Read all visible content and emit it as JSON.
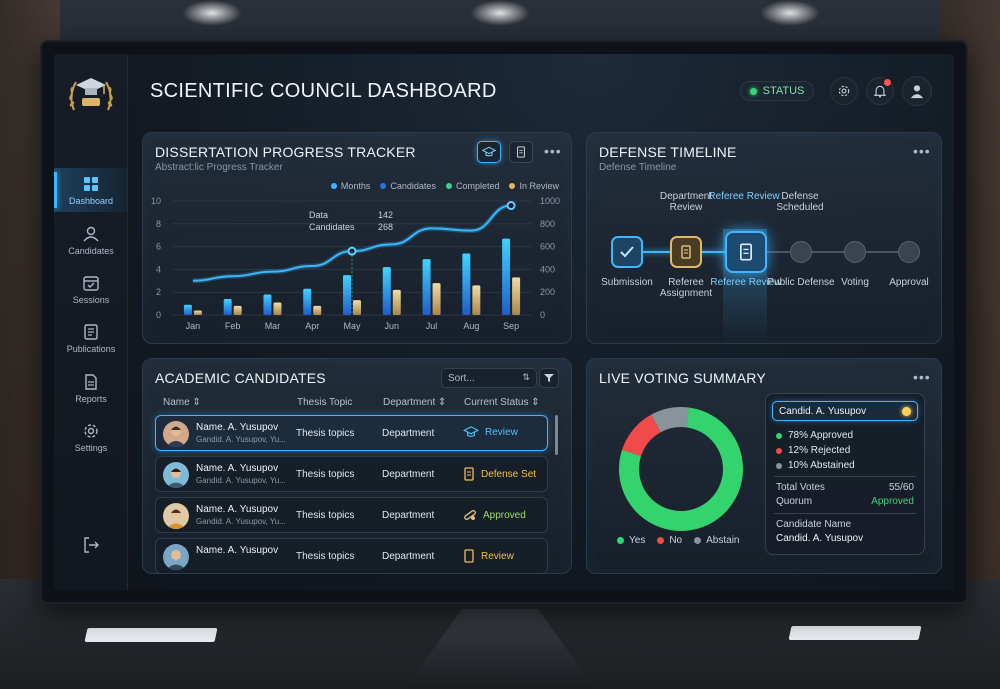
{
  "header": {
    "title": "SCIENTIFIC COUNCIL DASHBOARD",
    "status_label": "STATUS"
  },
  "sidebar": {
    "items": [
      {
        "label": "Dashboard",
        "icon": "dashboard-icon"
      },
      {
        "label": "Candidates",
        "icon": "candidates-icon"
      },
      {
        "label": "Sessions",
        "icon": "calendar-icon"
      },
      {
        "label": "Publications",
        "icon": "publications-icon"
      },
      {
        "label": "Reports",
        "icon": "reports-icon"
      },
      {
        "label": "Settings",
        "icon": "gear-icon"
      }
    ]
  },
  "tracker": {
    "title": "DISSERTATION PROGRESS TRACKER",
    "subtitle": "Abstract:lic Progress Tracker",
    "tooltip": {
      "label1": "Data",
      "value1": "142",
      "label2": "Candidates",
      "value2": "268"
    }
  },
  "chart_data": {
    "type": "bar",
    "categories": [
      "Jan",
      "Feb",
      "Mar",
      "Apr",
      "May",
      "Jun",
      "Jul",
      "Aug",
      "Sep"
    ],
    "legend": [
      "Months",
      "Candidates",
      "Completed",
      "In Review"
    ],
    "left_ticks": [
      "0",
      "2",
      "4",
      "6",
      "8",
      "10"
    ],
    "right_ticks": [
      "0",
      "200",
      "400",
      "600",
      "800",
      "1000"
    ],
    "ylim_left": [
      0,
      10
    ],
    "ylim_right": [
      0,
      1000
    ],
    "series": [
      {
        "name": "Candidates",
        "axis": "left",
        "values": [
          0.9,
          1.4,
          1.8,
          2.3,
          3.5,
          4.2,
          4.9,
          5.4,
          6.7
        ],
        "color": "#2f8fe8"
      },
      {
        "name": "In Review",
        "axis": "left",
        "values": [
          0.4,
          0.8,
          1.1,
          0.8,
          1.3,
          2.2,
          2.8,
          2.6,
          3.3
        ],
        "color": "#e2c27d"
      },
      {
        "name": "Months",
        "axis": "right",
        "values": [
          300,
          340,
          380,
          430,
          560,
          620,
          760,
          740,
          960
        ],
        "color": "#38b8ff"
      }
    ],
    "colors": {
      "Months": "#38b8ff",
      "Candidates": "#2f6fe0",
      "Completed": "#3fd190",
      "In Review": "#e2b867"
    }
  },
  "timeline": {
    "title": "DEFENSE TIMELINE",
    "subtitle": "Defense Timeline",
    "top_labels": [
      "Department Review",
      "Referee Review",
      "Defense Scheduled"
    ],
    "steps": [
      "Submission",
      "Referee Assignment",
      "Referee Review",
      "Public Defense",
      "Voting",
      "Approval"
    ]
  },
  "candidates": {
    "title": "ACADEMIC CANDIDATES",
    "sort_placeholder": "Sort...",
    "columns": [
      "Name",
      "Thesis Topic",
      "Department",
      "Current Status"
    ],
    "rows": [
      {
        "name": "Name. A. Yusupov",
        "sub": "Gandid. A. Yusupov, Yu...",
        "topic": "Thesis topics",
        "dept": "Department",
        "status": "Review",
        "status_icon": "graduation-cap-icon",
        "status_color": "#4fc3ff"
      },
      {
        "name": "Name. A. Yusupov",
        "sub": "Gandid. A. Yusupov, Yu...",
        "topic": "Thesis topics",
        "dept": "Department",
        "status": "Defense Set",
        "status_icon": "scroll-icon",
        "status_color": "#f0c04a"
      },
      {
        "name": "Name. A. Yusupov",
        "sub": "Gandid. A. Yusupov, Yu...",
        "topic": "Thesis topics",
        "dept": "Department",
        "status": "Approved",
        "status_icon": "diploma-icon",
        "status_color": "#9fdc6a"
      },
      {
        "name": "Name. A. Yusupov",
        "sub": "",
        "topic": "Thesis topics",
        "dept": "Department",
        "status": "Review",
        "status_icon": "scroll-icon",
        "status_color": "#f0c04a"
      }
    ]
  },
  "voting": {
    "title": "LIVE VOTING SUMMARY",
    "candidate": "Candid. A. Yusupov",
    "approved": "78% Approved",
    "rejected": "12% Rejected",
    "abstained": "10% Abstained",
    "total_label": "Total Votes",
    "total_value": "55/60",
    "quorum_label": "Quorum",
    "quorum_value": "Approved",
    "cand_label": "Candidate Name",
    "cand_value": "Candid. A. Yusupov",
    "legend": [
      "Yes",
      "No",
      "Abstain"
    ],
    "shares": {
      "yes": 78,
      "no": 12,
      "abstain": 10
    },
    "colors": {
      "yes": "#33d36e",
      "no": "#f04a4a",
      "abstain": "#8a939c"
    }
  }
}
